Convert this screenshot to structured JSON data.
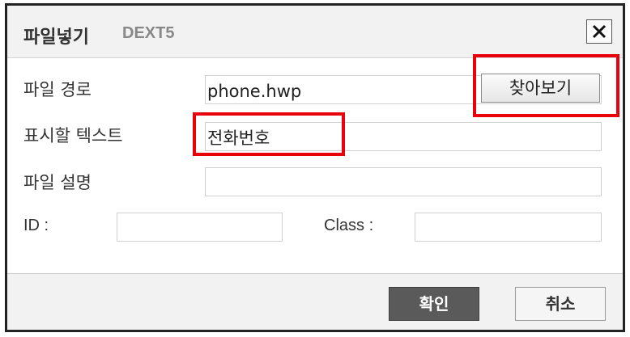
{
  "dialog": {
    "title": "파일넣기",
    "brand": "DEXT5",
    "close_icon": "close-icon"
  },
  "form": {
    "path_label": "파일 경로",
    "path_value": "phone.hwp",
    "browse_label": "찾아보기",
    "display_text_label": "표시할 텍스트",
    "display_text_value": "전화번호",
    "description_label": "파일 설명",
    "description_value": "",
    "id_label": "ID :",
    "id_value": "",
    "class_label": "Class :",
    "class_value": ""
  },
  "footer": {
    "ok_label": "확인",
    "cancel_label": "취소"
  },
  "highlight_color": "#e8000b"
}
